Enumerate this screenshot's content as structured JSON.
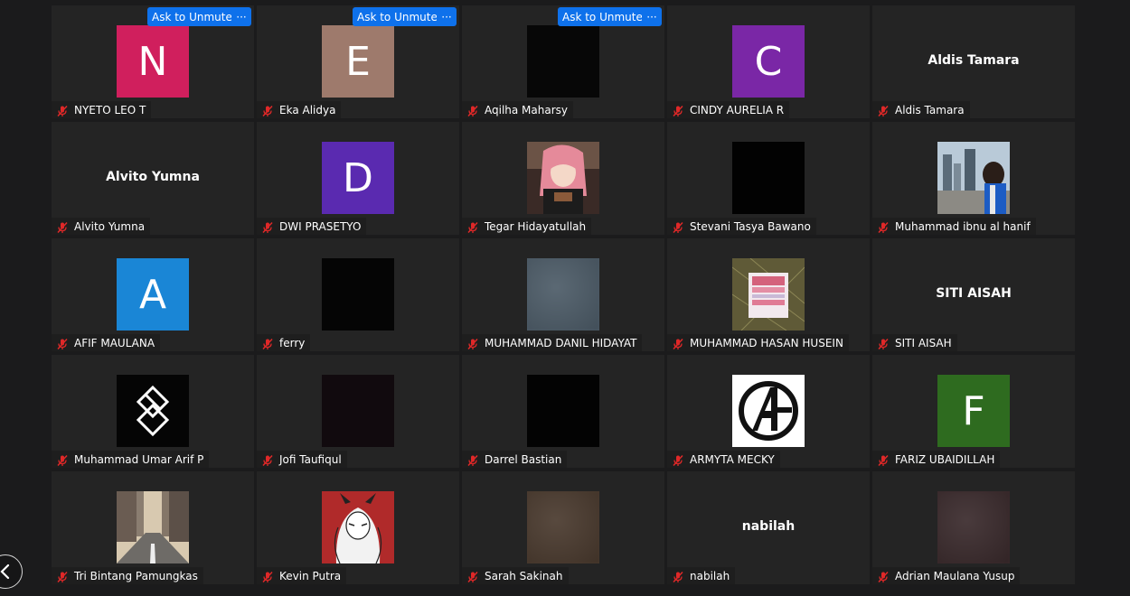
{
  "controls": {
    "ask_unmute_label": "Ask to Unmute",
    "more_label": "···"
  },
  "participants": [
    {
      "name": "NYETO LEO T",
      "initial": "N",
      "bg": "#d01f5d",
      "ask": true
    },
    {
      "name": "Eka Alidya",
      "initial": "E",
      "bg": "#9e7a6c",
      "ask": true
    },
    {
      "name": "Aqilha Maharsy",
      "photo": "dark",
      "bg": "#070707",
      "ask": true
    },
    {
      "name": "CINDY AURELIA R",
      "initial": "C",
      "bg": "#7a27a6"
    },
    {
      "name": "Aldis Tamara",
      "big": "Aldis Tamara"
    },
    {
      "name": "Alvito Yumna",
      "big": "Alvito Yumna"
    },
    {
      "name": "DWI PRASETYO",
      "initial": "D",
      "bg": "#5a2ab0"
    },
    {
      "name": "Tegar Hidayatullah",
      "photo": "anime",
      "bg": "#5a4038"
    },
    {
      "name": "Stevani Tasya Bawano",
      "photo": "dark",
      "bg": "#020202"
    },
    {
      "name": "Muhammad ibnu al hanif",
      "photo": "city",
      "bg": "#8fa4b8"
    },
    {
      "name": "AFIF MAULANA",
      "initial": "A",
      "bg": "#1a86d6"
    },
    {
      "name": "ferry",
      "photo": "dark",
      "bg": "#050505"
    },
    {
      "name": "MUHAMMAD DANIL HIDAYAT",
      "photo": "blur",
      "bg": "#4d5c68"
    },
    {
      "name": "MUHAMMAD HASAN HUSEIN",
      "photo": "poster",
      "bg": "#6f6a43"
    },
    {
      "name": "SITI AISAH",
      "big": "SITI AISAH"
    },
    {
      "name": "Muhammad Umar Arif P",
      "photo": "logo",
      "bg": "#050505"
    },
    {
      "name": "Jofi Taufiqul",
      "photo": "dark",
      "bg": "#110a0e"
    },
    {
      "name": "Darrel Bastian",
      "photo": "dark",
      "bg": "#030303"
    },
    {
      "name": "ARMYTA MECKY",
      "photo": "avengers",
      "bg": "#ffffff"
    },
    {
      "name": "FARIZ UBAIDILLAH",
      "initial": "F",
      "bg": "#2e6b1f"
    },
    {
      "name": "Tri Bintang Pamungkas",
      "photo": "street",
      "bg": "#8a8680"
    },
    {
      "name": "Kevin Putra",
      "photo": "manga",
      "bg": "#b02a2a"
    },
    {
      "name": "Sarah Sakinah",
      "photo": "blur",
      "bg": "#4a3a2e"
    },
    {
      "name": "nabilah",
      "big": "nabilah"
    },
    {
      "name": "Adrian Maulana Yusup",
      "photo": "blur",
      "bg": "#3a2a2c"
    }
  ]
}
